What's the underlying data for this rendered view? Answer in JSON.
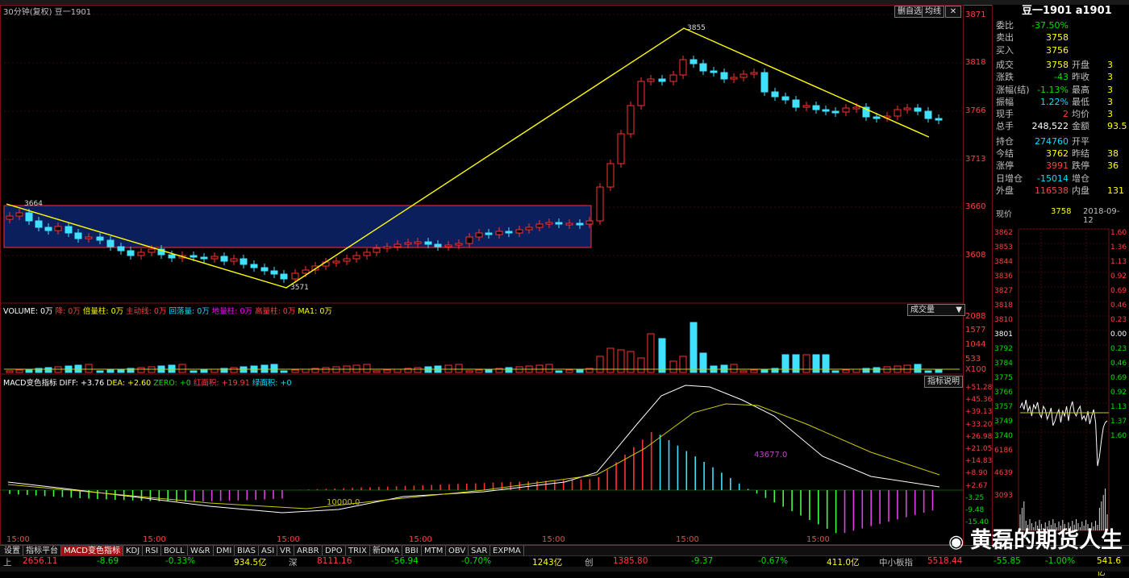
{
  "chart_header": {
    "title": "30分钟(复权)  豆一1901",
    "buttons": [
      "删自选",
      "均线"
    ],
    "price_ticks": [
      "3871",
      "3818",
      "3766",
      "3713",
      "3660",
      "3608"
    ],
    "annotations": {
      "high": "3855",
      "peak_left": "3664",
      "low": "3571"
    },
    "time_labels": [
      "15:00",
      "15:00",
      "15:00",
      "15:00",
      "15:00",
      "15:00",
      "15:00"
    ]
  },
  "volume": {
    "legend": [
      {
        "text": "VOLUME: 0万",
        "color": "#ffffff"
      },
      {
        "text": "降: 0万",
        "color": "#ff4040"
      },
      {
        "text": "倍量柱: 0万",
        "color": "#ffff00"
      },
      {
        "text": "主动线: 0万",
        "color": "#ff4040"
      },
      {
        "text": "回落量: 0万",
        "color": "#00e0ff"
      },
      {
        "text": "地量柱: 0万",
        "color": "#ff00ff"
      },
      {
        "text": "高量柱: 0万",
        "color": "#ff4040"
      },
      {
        "text": "MA1: 0万",
        "color": "#ffff00"
      }
    ],
    "dropdown": "成交量",
    "ticks": [
      "2088",
      "1577",
      "1044",
      "533",
      "X100"
    ]
  },
  "macd": {
    "legend": [
      {
        "text": "MACD变色指标  DIFF: +3.76",
        "color": "#ffffff"
      },
      {
        "text": "DEA: +2.60",
        "color": "#ffff00"
      },
      {
        "text": "ZERO: +0",
        "color": "#00e000"
      },
      {
        "text": "红面积: +19.91",
        "color": "#ff4040"
      },
      {
        "text": "绿面积: +0",
        "color": "#00e0ff"
      }
    ],
    "button": "指标说明",
    "ticks": [
      "+51.28",
      "+45.36",
      "+39.13",
      "+33.20",
      "+26.98",
      "+21.05",
      "+14.83",
      "+8.90",
      "+2.67",
      "-3.25",
      "-9.48",
      "-15.40"
    ],
    "area_labels": [
      "43677.0",
      "10000.0"
    ]
  },
  "tabs": [
    "设置",
    "指标平台",
    "MACD变色指标",
    "KDJ",
    "RSI",
    "BOLL",
    "W&R",
    "DMI",
    "BIAS",
    "ASI",
    "VR",
    "ARBR",
    "DPO",
    "TRIX",
    "新DMA",
    "BBI",
    "MTM",
    "OBV",
    "SAR",
    "EXPMA"
  ],
  "status_bar": {
    "sh_index": "2656.11",
    "sh_change": "-8.69",
    "sh_pct": "-0.33%",
    "sh_amount": "934.5亿",
    "sz_label": "深",
    "sz_index": "8111.16",
    "sz_change": "-56.94",
    "sz_pct": "-0.70%",
    "sz_amount": "1243亿",
    "cy_label": "创",
    "cy_index": "1385.80",
    "cy_change": "-9.37",
    "cy_pct": "-0.67%",
    "cy_amount": "411.0亿",
    "zx_label": "中小板指",
    "zx_index": "5518.44",
    "zx_change": "-55.85",
    "zx_pct": "-1.00%",
    "zx_amount": "541.6亿"
  },
  "quote_panel": {
    "title": "豆一1901  a1901",
    "rows": [
      {
        "label": "委比",
        "value": "-37.50%",
        "vcolor": "grn"
      },
      {
        "label": "卖出",
        "value": "3758",
        "vcolor": "yel"
      },
      {
        "label": "买入",
        "value": "3756",
        "vcolor": "yel"
      },
      {
        "label": "成交",
        "value": "3758",
        "vcolor": "yel",
        "label2": "开盘",
        "value2": "3"
      },
      {
        "label": "涨跌",
        "value": "-43",
        "vcolor": "grn",
        "label2": "昨收",
        "value2": "3"
      },
      {
        "label": "涨幅(结)",
        "value": "-1.13%",
        "vcolor": "grn",
        "label2": "最高",
        "value2": "3"
      },
      {
        "label": "振幅",
        "value": "1.22%",
        "vcolor": "cyn",
        "label2": "最低",
        "value2": "3"
      },
      {
        "label": "现手",
        "value": "2",
        "vcolor": "red",
        "label2": "均价",
        "value2": "3"
      },
      {
        "label": "总手",
        "value": "248,522",
        "vcolor": "wht",
        "label2": "金额",
        "value2": "93.5"
      },
      {
        "label": "持仓",
        "value": "274760",
        "vcolor": "cyn",
        "label2": "开平",
        "value2": ""
      },
      {
        "label": "今结",
        "value": "3762",
        "vcolor": "yel",
        "label2": "昨结",
        "value2": "38"
      },
      {
        "label": "涨停",
        "value": "3991",
        "vcolor": "red",
        "label2": "跌停",
        "value2": "36"
      },
      {
        "label": "日增仓",
        "value": "-15014",
        "vcolor": "cyn",
        "label2": "增仓",
        "value2": ""
      },
      {
        "label": "外盘",
        "value": "116538",
        "vcolor": "red",
        "label2": "内盘",
        "value2": "131"
      }
    ],
    "now_label": "现价",
    "now_value": "3758",
    "now_date": "2018-09-12",
    "mini_ticks": [
      "3862",
      "3853",
      "3844",
      "3836",
      "3827",
      "3818",
      "3810",
      "3801",
      "3792",
      "3784",
      "3775",
      "3766",
      "3757",
      "3749",
      "3740",
      "6186",
      "4639",
      "3093"
    ],
    "mini_right": [
      "1.60",
      "1.36",
      "1.13",
      "0.92",
      "0.69",
      "0.46",
      "0.23",
      "0.00",
      "0.23",
      "0.46",
      "0.69",
      "0.92",
      "1.13",
      "1.37",
      "1.60"
    ]
  },
  "watermark": "黄磊的期货人生"
}
